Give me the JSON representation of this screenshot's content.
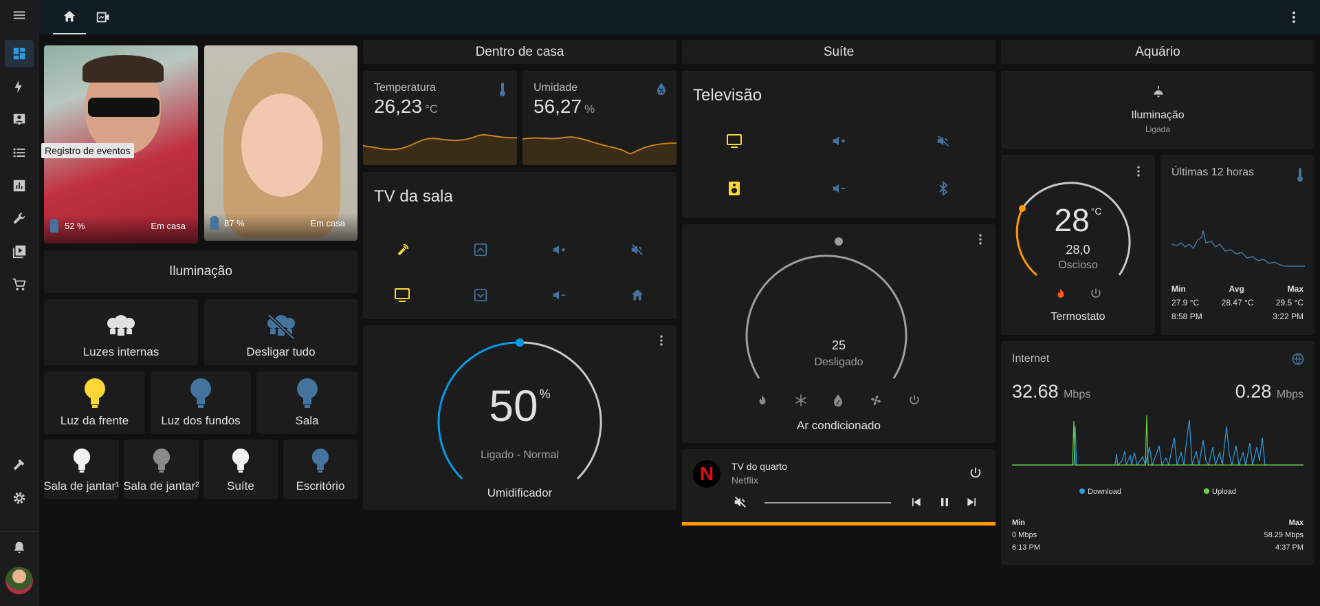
{
  "nav": {
    "tooltip": "Registro de eventos"
  },
  "persons": [
    {
      "battery": "52 %",
      "status": "Em casa"
    },
    {
      "battery": "87 %",
      "status": "Em casa"
    }
  ],
  "lighting": {
    "title": "Iluminação",
    "tiles": [
      {
        "label": "Luzes internas"
      },
      {
        "label": "Desligar tudo"
      },
      {
        "label": "Luz da frente"
      },
      {
        "label": "Luz dos fundos"
      },
      {
        "label": "Sala"
      },
      {
        "label": "Sala de jantar¹"
      },
      {
        "label": "Sala de jantar²"
      },
      {
        "label": "Suíte"
      },
      {
        "label": "Escritório"
      }
    ]
  },
  "inside": {
    "title": "Dentro de casa",
    "temperature": {
      "name": "Temperatura",
      "value": "26,23",
      "unit": "°C"
    },
    "humidity": {
      "name": "Umidade",
      "value": "56,27",
      "unit": "%"
    }
  },
  "tv_sala": {
    "title": "TV da sala"
  },
  "humidifier": {
    "value": "50",
    "unit": "%",
    "state": "Ligado - Normal",
    "name": "Umidificador",
    "level": 50
  },
  "suite": {
    "title": "Suíte",
    "tv_title": "Televisão",
    "ac": {
      "value": "25",
      "state": "Desligado",
      "name": "Ar condicionado"
    },
    "media": {
      "title": "TV do quarto",
      "app": "Netflix",
      "logo": "N"
    }
  },
  "aquario": {
    "title": "Aquário",
    "light": {
      "name": "Iluminação",
      "state": "Ligada"
    },
    "thermostat": {
      "value": "28",
      "unit": "°C",
      "current": "28,0",
      "state": "Oscioso",
      "name": "Termostato"
    },
    "history": {
      "title": "Últimas 12 horas",
      "labels": [
        "Min",
        "Avg",
        "Max"
      ],
      "values": [
        "27.9 °C",
        "28.47 °C",
        "29.5 °C"
      ],
      "times": [
        "8:58 PM",
        "",
        "3:22 PM"
      ]
    }
  },
  "internet": {
    "title": "Internet",
    "download": {
      "value": "32.68",
      "unit": "Mbps"
    },
    "upload": {
      "value": "0.28",
      "unit": "Mbps"
    },
    "legend": [
      "Download",
      "Upload"
    ],
    "min_label": "Min",
    "max_label": "Max",
    "min_value": "0 Mbps",
    "max_value": "58.29 Mbps",
    "min_time": "6:13 PM",
    "max_time": "4:37 PM"
  },
  "colors": {
    "accent_blue": "#44739e",
    "active_yellow": "#fdd835",
    "orange": "#ff9800",
    "humid_blue": "#039be5",
    "upload_green": "#6bd63b",
    "download_blue": "#2d9be0"
  }
}
